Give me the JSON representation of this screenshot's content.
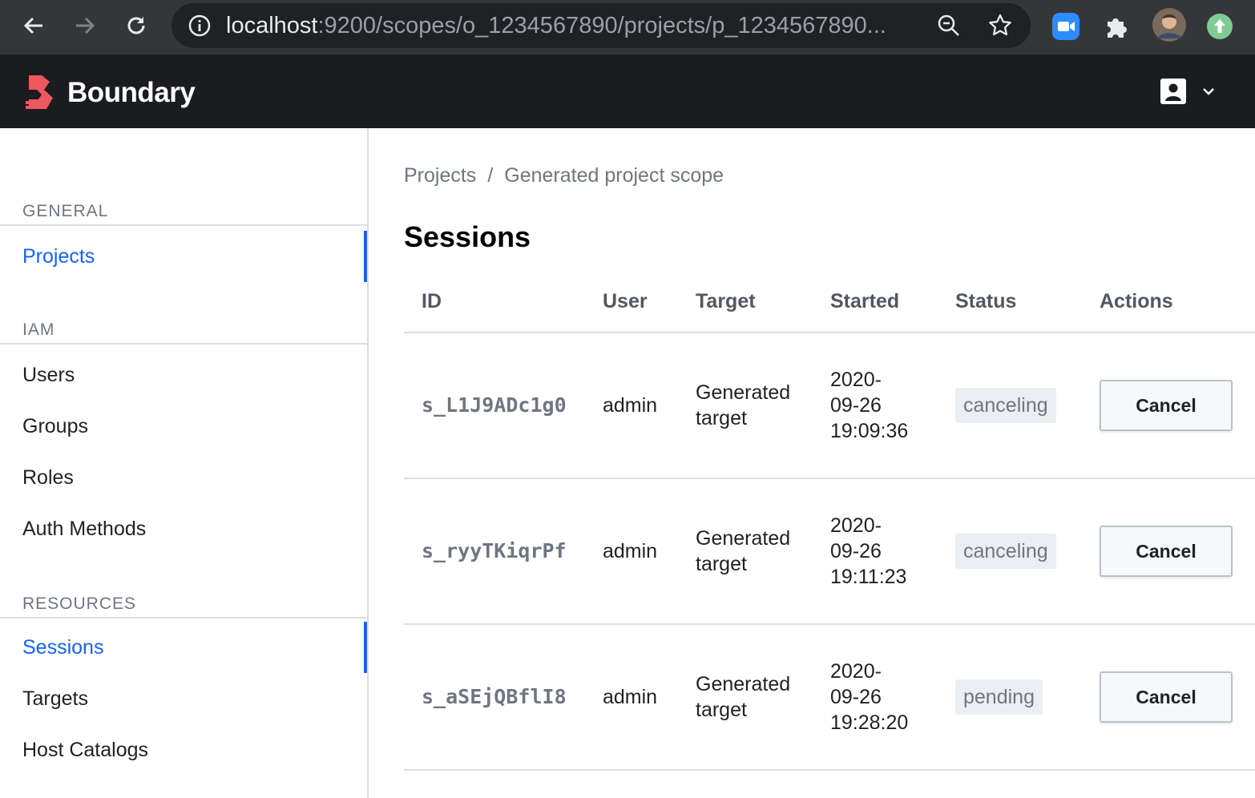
{
  "browser": {
    "url_host": "localhost",
    "url_path": ":9200/scopes/o_1234567890/projects/p_1234567890...",
    "icons": [
      "back-arrow-icon",
      "forward-arrow-icon",
      "reload-icon",
      "info-icon",
      "zoom-icon",
      "star-icon",
      "zoom-meeting-extension-icon",
      "puzzle-extension-icon",
      "profile-avatar",
      "update-icon"
    ]
  },
  "header": {
    "brand": "Boundary",
    "brand_color": "#ec585d"
  },
  "sidebar": {
    "sections": [
      {
        "title": "GENERAL",
        "items": [
          {
            "label": "Projects",
            "active": true
          }
        ]
      },
      {
        "title": "IAM",
        "items": [
          {
            "label": "Users"
          },
          {
            "label": "Groups"
          },
          {
            "label": "Roles"
          },
          {
            "label": "Auth Methods"
          }
        ]
      },
      {
        "title": "RESOURCES",
        "items": [
          {
            "label": "Sessions",
            "active": true
          },
          {
            "label": "Targets"
          },
          {
            "label": "Host Catalogs"
          }
        ]
      }
    ]
  },
  "breadcrumb": {
    "root": "Projects",
    "separator": "/",
    "current": "Generated project scope"
  },
  "page": {
    "title": "Sessions"
  },
  "table": {
    "columns": [
      "ID",
      "User",
      "Target",
      "Started",
      "Status",
      "Actions"
    ],
    "rows": [
      {
        "id": "s_L1J9ADc1g0",
        "user": "admin",
        "target": "Generated target",
        "started_l1": "2020-",
        "started_l2": "09-26",
        "started_l3": "19:09:36",
        "status": "canceling",
        "action": "Cancel"
      },
      {
        "id": "s_ryyTKiqrPf",
        "user": "admin",
        "target": "Generated target",
        "started_l1": "2020-",
        "started_l2": "09-26",
        "started_l3": "19:11:23",
        "status": "canceling",
        "action": "Cancel"
      },
      {
        "id": "s_aSEjQBflI8",
        "user": "admin",
        "target": "Generated target",
        "started_l1": "2020-",
        "started_l2": "09-26",
        "started_l3": "19:28:20",
        "status": "pending",
        "action": "Cancel"
      }
    ]
  },
  "colors": {
    "accent": "#1563ff",
    "header_bg": "#1b1c1f",
    "chrome_bg": "#35363a"
  }
}
